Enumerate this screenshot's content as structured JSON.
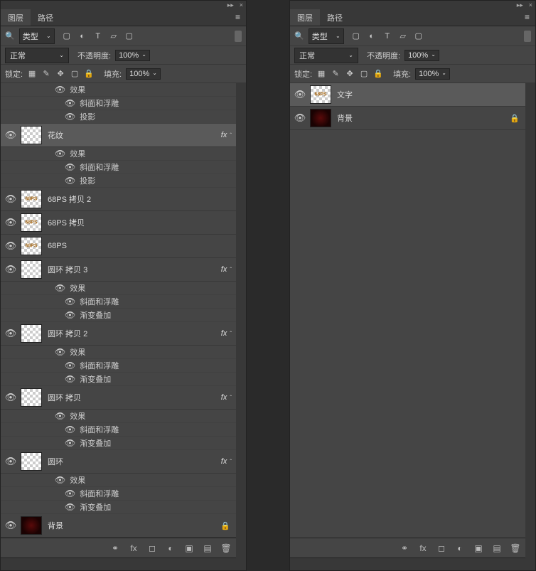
{
  "titlebar": {
    "collapse": "▸▸",
    "close": "×"
  },
  "tabs": {
    "layers": "图层",
    "paths": "路径",
    "menu_icon": "≡"
  },
  "filter": {
    "search_icon": "🔍",
    "kind_label": "类型",
    "icons": {
      "image": "▢",
      "adjust": "◐",
      "text": "T",
      "shape": "▱",
      "smart": "▢"
    }
  },
  "blend": {
    "mode": "正常",
    "opacity_label": "不透明度:",
    "opacity_value": "100%"
  },
  "lock": {
    "label": "锁定:",
    "icons": {
      "trans": "▦",
      "paint": "✎",
      "pos": "✥",
      "nest": "▢",
      "all": "🔒"
    },
    "fill_label": "填充:",
    "fill_value": "100%"
  },
  "left_panel": {
    "layers": [
      {
        "type": "effect_header",
        "label": "效果"
      },
      {
        "type": "effect_item",
        "label": "斜面和浮雕"
      },
      {
        "type": "effect_item",
        "label": "投影"
      },
      {
        "type": "layer",
        "name": "花纹",
        "thumb": "checker",
        "fx": true,
        "fx_open": true,
        "selected": true
      },
      {
        "type": "effect_header",
        "label": "效果"
      },
      {
        "type": "effect_item",
        "label": "斜面和浮雕"
      },
      {
        "type": "effect_item",
        "label": "投影"
      },
      {
        "type": "layer",
        "name": "68PS 拷贝 2",
        "thumb": "68ps",
        "fx": false
      },
      {
        "type": "layer",
        "name": "68PS 拷贝",
        "thumb": "68ps",
        "fx": false
      },
      {
        "type": "layer",
        "name": "68PS",
        "thumb": "68ps",
        "fx": false
      },
      {
        "type": "layer",
        "name": "圆环 拷贝 3",
        "thumb": "checker",
        "fx": true,
        "fx_open": true
      },
      {
        "type": "effect_header",
        "label": "效果"
      },
      {
        "type": "effect_item",
        "label": "斜面和浮雕"
      },
      {
        "type": "effect_item",
        "label": "渐变叠加"
      },
      {
        "type": "layer",
        "name": "圆环 拷贝 2",
        "thumb": "checker",
        "fx": true,
        "fx_open": true
      },
      {
        "type": "effect_header",
        "label": "效果"
      },
      {
        "type": "effect_item",
        "label": "斜面和浮雕"
      },
      {
        "type": "effect_item",
        "label": "渐变叠加"
      },
      {
        "type": "layer",
        "name": "圆环 拷贝",
        "thumb": "checker",
        "fx": true,
        "fx_open": true
      },
      {
        "type": "effect_header",
        "label": "效果"
      },
      {
        "type": "effect_item",
        "label": "斜面和浮雕"
      },
      {
        "type": "effect_item",
        "label": "渐变叠加"
      },
      {
        "type": "layer",
        "name": "圆环",
        "thumb": "checker",
        "fx": true,
        "fx_open": true
      },
      {
        "type": "effect_header",
        "label": "效果"
      },
      {
        "type": "effect_item",
        "label": "斜面和浮雕"
      },
      {
        "type": "effect_item",
        "label": "渐变叠加"
      },
      {
        "type": "layer",
        "name": "背景",
        "thumb": "dark",
        "fx": false,
        "locked": true
      }
    ]
  },
  "right_panel": {
    "layers": [
      {
        "type": "layer",
        "name": "文字",
        "thumb": "68ps",
        "fx": false,
        "selected": true
      },
      {
        "type": "layer",
        "name": "背景",
        "thumb": "dark",
        "fx": false,
        "locked": true
      }
    ]
  },
  "footer": {
    "link": "⚭",
    "fx": "fx",
    "mask": "◻",
    "adjust": "◐",
    "group": "▣",
    "new": "▤",
    "trash": "🗑"
  },
  "thumb_text": "68PS"
}
